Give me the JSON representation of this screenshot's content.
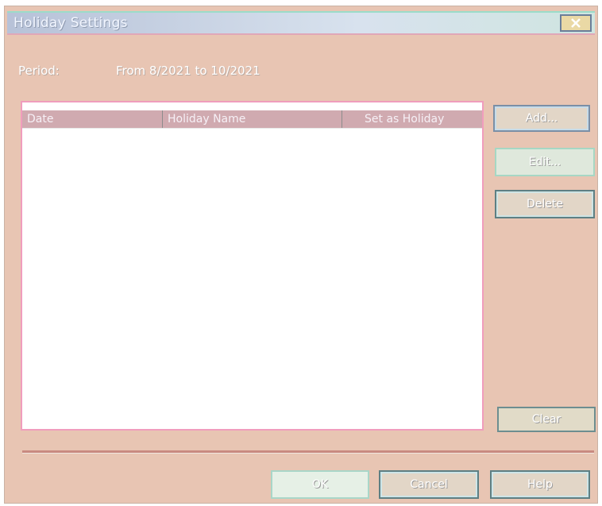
{
  "window": {
    "title": "Holiday Settings",
    "close_icon": "close-icon"
  },
  "period": {
    "label": "Period:",
    "value": "From 8/2021 to 10/2021"
  },
  "list": {
    "columns": [
      "Date",
      "Holiday Name",
      "Set as Holiday"
    ],
    "rows": []
  },
  "buttons": {
    "add": "Add...",
    "edit": "Edit...",
    "delete": "Delete",
    "clear": "Clear",
    "ok": "OK",
    "cancel": "Cancel",
    "help": "Help"
  },
  "colors": {
    "dialog_bg": "#e8c5b3",
    "titlebar": "#b7c2d8"
  }
}
